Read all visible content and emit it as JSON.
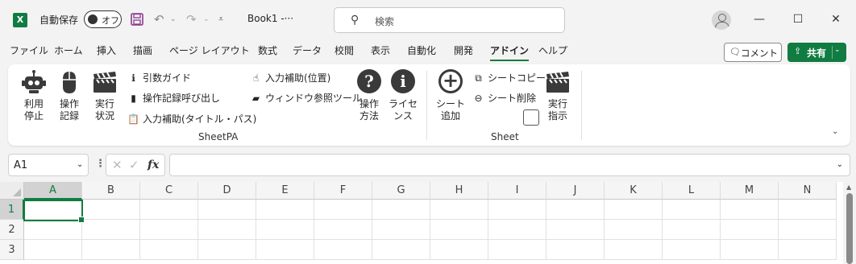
{
  "app": {
    "autosave_label": "自動保存",
    "autosave_state": "オフ",
    "doc_title": "Book1  -···",
    "search_placeholder": "検索",
    "logo_letter": "X"
  },
  "colors": {
    "accent": "#107c41"
  },
  "tabs": [
    "ファイル",
    "ホーム",
    "挿入",
    "描画",
    "ページ レイアウト",
    "数式",
    "データ",
    "校閲",
    "表示",
    "自動化",
    "開発",
    "アドイン",
    "ヘルプ"
  ],
  "active_tab": "アドイン",
  "top_right": {
    "comment_label": "コメント",
    "share_label": "共有"
  },
  "ribbon": {
    "sheetpa": {
      "label": "SheetPA",
      "stop": "利用\n停止",
      "record": "操作\n記録",
      "status": "実行\n状況",
      "arg_guide": "引数ガイド",
      "call_record": "操作記録呼び出し",
      "input_assist_title": "入力補助(タイトル・パス)",
      "input_assist_pos": "入力補助(位置)",
      "window_ref": "ウィンドウ参照ツール",
      "how_to": "操作\n方法",
      "license": "ライセ\nンス"
    },
    "sheet": {
      "label": "Sheet",
      "add": "シート\n追加",
      "copy": "シートコピー",
      "delete": "シート削除",
      "exec": "実行\n指示"
    }
  },
  "formula_bar": {
    "cell_ref": "A1",
    "value": ""
  },
  "grid": {
    "columns": [
      "A",
      "B",
      "C",
      "D",
      "E",
      "F",
      "G",
      "H",
      "I",
      "J",
      "K",
      "L",
      "M",
      "N"
    ],
    "rows": [
      "1",
      "2",
      "3"
    ],
    "active_cell": "A1"
  },
  "icons": [
    "excel-logo-icon",
    "save-icon",
    "undo-icon",
    "redo-icon",
    "customize-qat-icon",
    "search-icon",
    "minimize-icon",
    "maximize-icon",
    "close-icon",
    "robot-icon",
    "mouse-icon",
    "clapperboard-icon",
    "info-icon",
    "record-call-icon",
    "clipboard-icon",
    "finger-point-icon",
    "window-ref-icon",
    "help-icon",
    "license-info-icon",
    "add-sheet-icon",
    "copy-sheet-icon",
    "delete-sheet-icon",
    "fx-icon"
  ]
}
